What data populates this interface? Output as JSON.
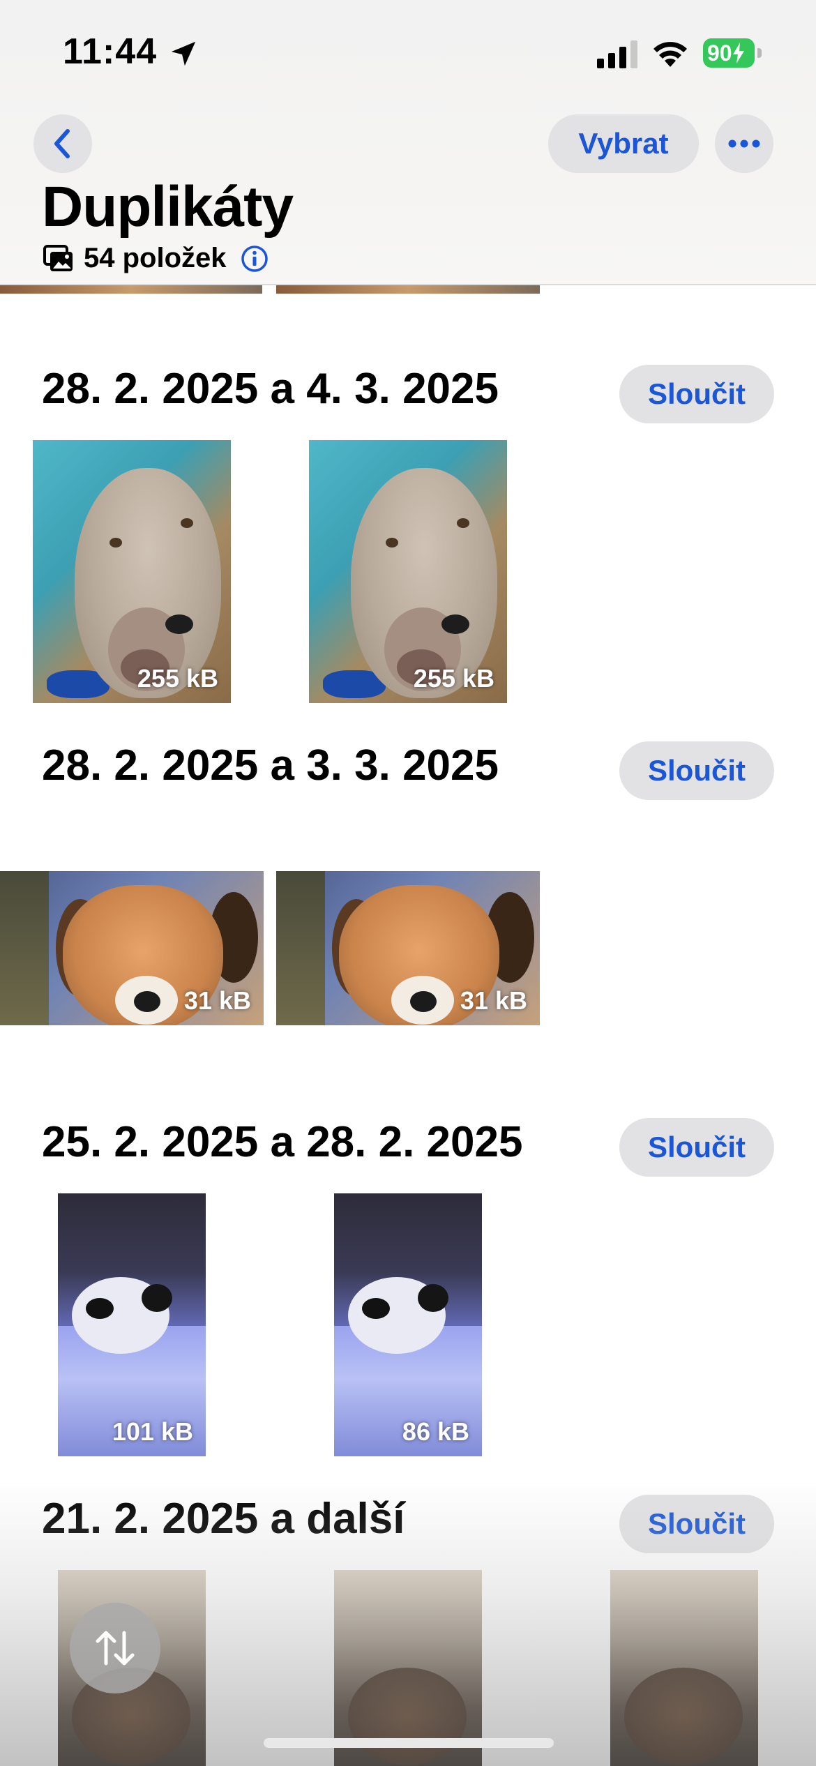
{
  "status_bar": {
    "time": "11:44",
    "battery": "90"
  },
  "header": {
    "title": "Duplikáty",
    "item_count": "54 položek",
    "select_label": "Vybrat"
  },
  "groups": [
    {
      "title": "28. 2. 2025 a 4. 3. 2025",
      "merge_label": "Sloučit",
      "sizes": [
        "255 kB",
        "255 kB"
      ]
    },
    {
      "title": "28. 2. 2025 a 3. 3. 2025",
      "merge_label": "Sloučit",
      "sizes": [
        "31 kB",
        "31 kB"
      ]
    },
    {
      "title": "25. 2. 2025 a 28. 2. 2025",
      "merge_label": "Sloučit",
      "sizes": [
        "101 kB",
        "86 kB"
      ]
    },
    {
      "title": "21. 2. 2025 a další",
      "merge_label": "Sloučit",
      "sizes": []
    }
  ],
  "icons": {
    "back": "chevron-left-icon",
    "more": "ellipsis-icon",
    "location": "location-arrow-icon",
    "sort": "sort-arrows-icon",
    "info": "info-icon",
    "photos": "photo-stack-icon"
  },
  "colors": {
    "accent": "#1a56d6",
    "button_bg": "#e2e2e4",
    "battery": "#34c759"
  }
}
